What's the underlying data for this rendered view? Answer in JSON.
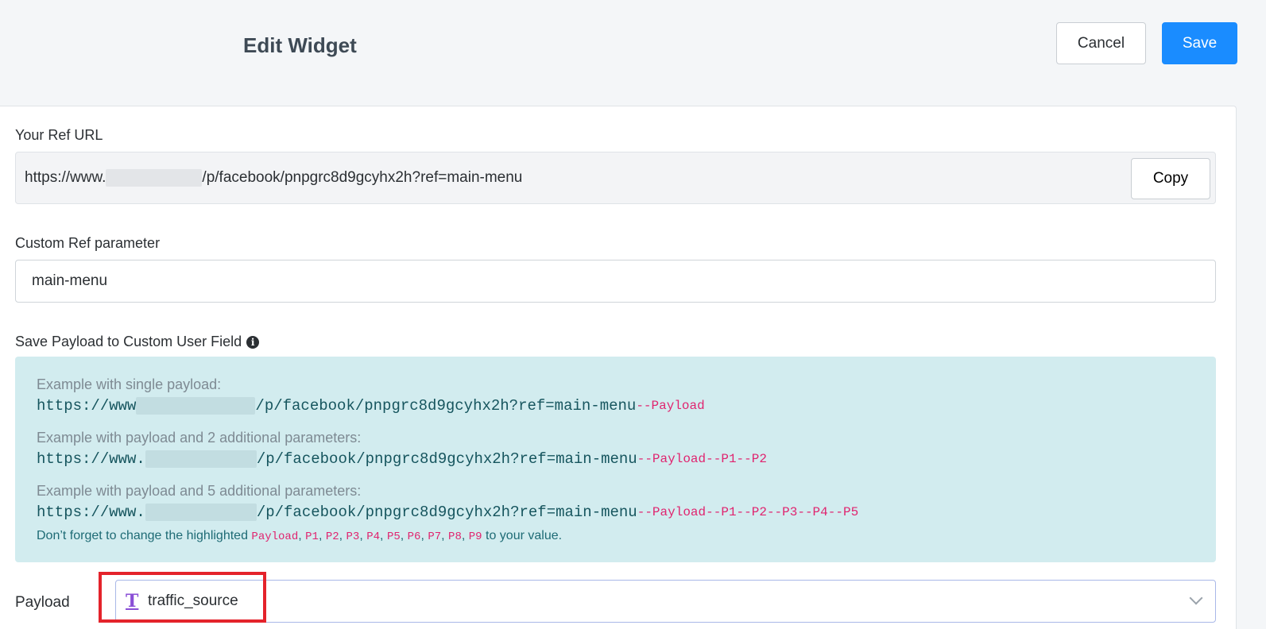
{
  "header": {
    "title": "Edit Widget",
    "cancel_label": "Cancel",
    "save_label": "Save"
  },
  "ref_url": {
    "label": "Your Ref URL",
    "prefix": "https://www.",
    "suffix": "/p/facebook/pnpgrc8d9gcyhx2h?ref=main-menu",
    "copy_label": "Copy"
  },
  "custom_ref": {
    "label": "Custom Ref parameter",
    "value": "main-menu"
  },
  "save_payload": {
    "label": "Save Payload to Custom User Field",
    "info_icon": "info-circle-icon"
  },
  "examples": [
    {
      "label": "Example with single payload:",
      "prefix": "https://www",
      "suffix": "/p/facebook/pnpgrc8d9gcyhx2h?ref=main-menu",
      "params": "--Payload"
    },
    {
      "label": "Example with payload and 2 additional parameters:",
      "prefix": "https://www.",
      "suffix": "/p/facebook/pnpgrc8d9gcyhx2h?ref=main-menu",
      "params": "--Payload--P1--P2"
    },
    {
      "label": "Example with payload and 5 additional parameters:",
      "prefix": "https://www.",
      "suffix": "/p/facebook/pnpgrc8d9gcyhx2h?ref=main-menu",
      "params": "--Payload--P1--P2--P3--P4--P5"
    }
  ],
  "note": {
    "before": "Don’t forget to change the highlighted ",
    "tokens": [
      "Payload",
      "P1",
      "P2",
      "P3",
      "P4",
      "P5",
      "P6",
      "P7",
      "P8",
      "P9"
    ],
    "after": " to your value."
  },
  "payload": {
    "label": "Payload",
    "icon": "text-type-icon",
    "value": "traffic_source"
  },
  "colors": {
    "accent": "#1a8cff",
    "highlight": "#e0246f",
    "info_bg": "#d2ecef",
    "frame": "#e4232b"
  }
}
